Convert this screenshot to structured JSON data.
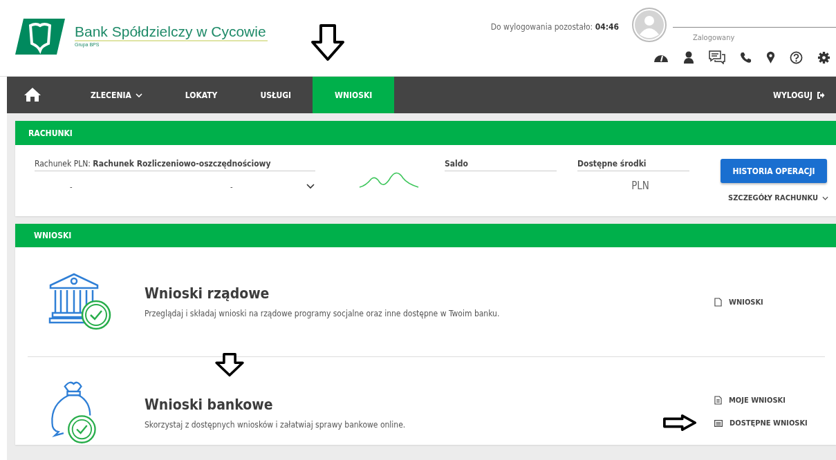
{
  "header": {
    "logo": {
      "name": "Bank Spółdzielczy w Cycowie",
      "group": "Grupa BPS"
    },
    "session": {
      "label": "Do wylogowania pozostało:",
      "time": "04:46"
    },
    "user": {
      "status": "Zalogowany"
    }
  },
  "nav": {
    "items": [
      {
        "label": "ZLECENIA",
        "selected": false,
        "dropdown": true
      },
      {
        "label": "LOKATY",
        "selected": false,
        "dropdown": false
      },
      {
        "label": "USŁUGI",
        "selected": false,
        "dropdown": false
      },
      {
        "label": "WNIOSKI",
        "selected": true,
        "dropdown": false
      }
    ],
    "logout": "WYLOGUJ"
  },
  "accounts": {
    "title": "RACHUNKI",
    "account_label": "Rachunek PLN:",
    "account_name": "Rachunek Rozliczeniowo-oszczędnościowy",
    "number_parts": [
      "-",
      "-"
    ],
    "balance_label": "Saldo",
    "available_label": "Dostępne środki",
    "currency": "PLN",
    "history_button": "HISTORIA OPERACJI",
    "details_link": "SZCZEGÓŁY RACHUNKU"
  },
  "applications": {
    "title": "WNIOSKI",
    "sections": [
      {
        "kind": "government",
        "title": "Wnioski rządowe",
        "description": "Przeglądaj i składaj wnioski na rządowe programy socjalne oraz inne dostępne w Twoim banku.",
        "links": [
          {
            "label": "WNIOSKI",
            "kind": "page"
          }
        ]
      },
      {
        "kind": "bank",
        "title": "Wnioski bankowe",
        "description": "Skorzystaj z dostępnych wniosków i załatwiaj sprawy bankowe online.",
        "links": [
          {
            "label": "MOJE WNIOSKI",
            "kind": "document"
          },
          {
            "label": "DOSTĘPNE WNIOSKI",
            "kind": "list"
          }
        ]
      }
    ]
  }
}
